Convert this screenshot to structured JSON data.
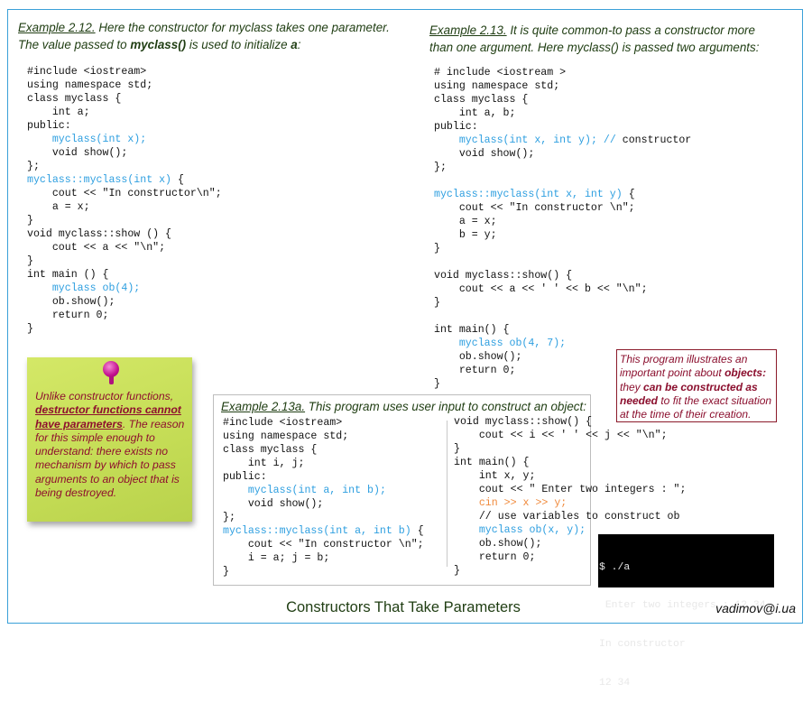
{
  "colors": {
    "frame": "#3aa0d8",
    "heading": "#1f3d12",
    "code_highlight": "#2e9fe0",
    "code_input": "#f08a3c",
    "note": "#8e0f2e",
    "sticky": "#c8e05a",
    "pin": "#c3128f",
    "terminal_bg": "#000000"
  },
  "example_212": {
    "heading": [
      {
        "t": "Example 2.12.",
        "s": "u"
      },
      {
        "t": " Here the constructor for myclass takes one parameter. The value passed to ",
        "s": ""
      },
      {
        "t": "myclass()",
        "s": "b"
      },
      {
        "t": " is used to initialize ",
        "s": ""
      },
      {
        "t": "a",
        "s": "b"
      },
      {
        "t": ":",
        "s": ""
      }
    ],
    "code": [
      [
        [
          "#include <iostream>",
          ""
        ]
      ],
      [
        [
          "using namespace std;",
          ""
        ]
      ],
      [
        [
          "class myclass {",
          ""
        ]
      ],
      [
        [
          "    int a;",
          ""
        ]
      ],
      [
        [
          "public:",
          ""
        ]
      ],
      [
        [
          "    ",
          ""
        ],
        [
          "myclass(int x);",
          "blue"
        ]
      ],
      [
        [
          "    void show();",
          ""
        ]
      ],
      [
        [
          "};",
          ""
        ]
      ],
      [
        [
          "myclass::myclass(int x)",
          "blue"
        ],
        [
          " {",
          ""
        ]
      ],
      [
        [
          "    cout << \"In constructor\\n\";",
          ""
        ]
      ],
      [
        [
          "    a = x;",
          ""
        ]
      ],
      [
        [
          "}",
          ""
        ]
      ],
      [
        [
          "void myclass::show () {",
          ""
        ]
      ],
      [
        [
          "    cout << a << \"\\n\";",
          ""
        ]
      ],
      [
        [
          "}",
          ""
        ]
      ],
      [
        [
          "int main () {",
          ""
        ]
      ],
      [
        [
          "    ",
          ""
        ],
        [
          "myclass ob(4);",
          "blue"
        ]
      ],
      [
        [
          "    ob.show();",
          ""
        ]
      ],
      [
        [
          "    return 0;",
          ""
        ]
      ],
      [
        [
          "}",
          ""
        ]
      ]
    ]
  },
  "example_213": {
    "heading": [
      {
        "t": "Example 2.13.",
        "s": "u"
      },
      {
        "t": " It is quite common-to pass a constructor more than one argument. Here myclass() is passed two arguments:",
        "s": ""
      }
    ],
    "code": [
      [
        [
          "# include <iostream >",
          ""
        ]
      ],
      [
        [
          "using namespace std;",
          ""
        ]
      ],
      [
        [
          "class myclass {",
          ""
        ]
      ],
      [
        [
          "    int a, b;",
          ""
        ]
      ],
      [
        [
          "public:",
          ""
        ]
      ],
      [
        [
          "    ",
          ""
        ],
        [
          "myclass(int x, int y); //",
          "blue"
        ],
        [
          " constructor",
          ""
        ]
      ],
      [
        [
          "    void show();",
          ""
        ]
      ],
      [
        [
          "};",
          ""
        ]
      ],
      [
        [
          "",
          ""
        ]
      ],
      [
        [
          "myclass::myclass(int x, int y)",
          "blue"
        ],
        [
          " {",
          ""
        ]
      ],
      [
        [
          "    cout << \"In constructor \\n\";",
          ""
        ]
      ],
      [
        [
          "    a = x;",
          ""
        ]
      ],
      [
        [
          "    b = y;",
          ""
        ]
      ],
      [
        [
          "}",
          ""
        ]
      ],
      [
        [
          "",
          ""
        ]
      ],
      [
        [
          "void myclass::show() {",
          ""
        ]
      ],
      [
        [
          "    cout << a << ' ' << b << \"\\n\";",
          ""
        ]
      ],
      [
        [
          "}",
          ""
        ]
      ],
      [
        [
          "",
          ""
        ]
      ],
      [
        [
          "int main() {",
          ""
        ]
      ],
      [
        [
          "    ",
          ""
        ],
        [
          "myclass ob(4, 7);",
          "blue"
        ]
      ],
      [
        [
          "    ob.show();",
          ""
        ]
      ],
      [
        [
          "    return 0;",
          ""
        ]
      ],
      [
        [
          "}",
          ""
        ]
      ]
    ]
  },
  "sticky_note": [
    {
      "t": "Unlike constructor functions, ",
      "s": ""
    },
    {
      "t": "destructor functions cannot have  parameters",
      "s": "bu"
    },
    {
      "t": ". The reason for this simple enough to understand:  there exists no mechanism by which to pass arguments to an object that is being destroyed.",
      "s": ""
    }
  ],
  "example_213a": {
    "heading": [
      {
        "t": "Example 2.13a.",
        "s": "u"
      },
      {
        "t": " This program uses user input to construct an object:",
        "s": ""
      }
    ],
    "code_left": [
      [
        [
          "#include <iostream>",
          ""
        ]
      ],
      [
        [
          "using namespace std;",
          ""
        ]
      ],
      [
        [
          "class myclass {",
          ""
        ]
      ],
      [
        [
          "    int i, j;",
          ""
        ]
      ],
      [
        [
          "public:",
          ""
        ]
      ],
      [
        [
          "    ",
          ""
        ],
        [
          "myclass(int a, int b);",
          "blue"
        ]
      ],
      [
        [
          "    void show();",
          ""
        ]
      ],
      [
        [
          "};",
          ""
        ]
      ],
      [
        [
          "myclass::myclass(int a, int b)",
          "blue"
        ],
        [
          " {",
          ""
        ]
      ],
      [
        [
          "    cout << \"In constructor \\n\";",
          ""
        ]
      ],
      [
        [
          "    i = a; j = b;",
          ""
        ]
      ],
      [
        [
          "}",
          ""
        ]
      ]
    ],
    "code_right": [
      [
        [
          "void myclass::show() {",
          ""
        ]
      ],
      [
        [
          "    cout << i << ' ' << j << \"\\n\";",
          ""
        ]
      ],
      [
        [
          "}",
          ""
        ]
      ],
      [
        [
          "int main() {",
          ""
        ]
      ],
      [
        [
          "    int x, y;",
          ""
        ]
      ],
      [
        [
          "    cout << \" Enter two integers : \";",
          ""
        ]
      ],
      [
        [
          "    ",
          ""
        ],
        [
          "cin >> x >> y;",
          "orange"
        ]
      ],
      [
        [
          "    // use variables to construct ob",
          ""
        ]
      ],
      [
        [
          "    ",
          ""
        ],
        [
          "myclass ob(x, y);",
          "blue"
        ]
      ],
      [
        [
          "    ob.show();",
          ""
        ]
      ],
      [
        [
          "    return 0;",
          ""
        ]
      ],
      [
        [
          "}",
          ""
        ]
      ]
    ]
  },
  "callout": [
    {
      "t": "This program illustrates an important point about ",
      "s": ""
    },
    {
      "t": "objects:",
      "s": "b"
    },
    {
      "t": " they ",
      "s": ""
    },
    {
      "t": "can be constructed as needed",
      "s": "b"
    },
    {
      "t": " to fit the exact situation at the time of their creation.",
      "s": ""
    }
  ],
  "terminal": {
    "lines": [
      "$ ./a",
      " Enter two integers : 12 34",
      "In constructor",
      "12 34"
    ]
  },
  "footer": {
    "title": "Constructors That Take Parameters",
    "author": "vadimov@i.ua"
  }
}
